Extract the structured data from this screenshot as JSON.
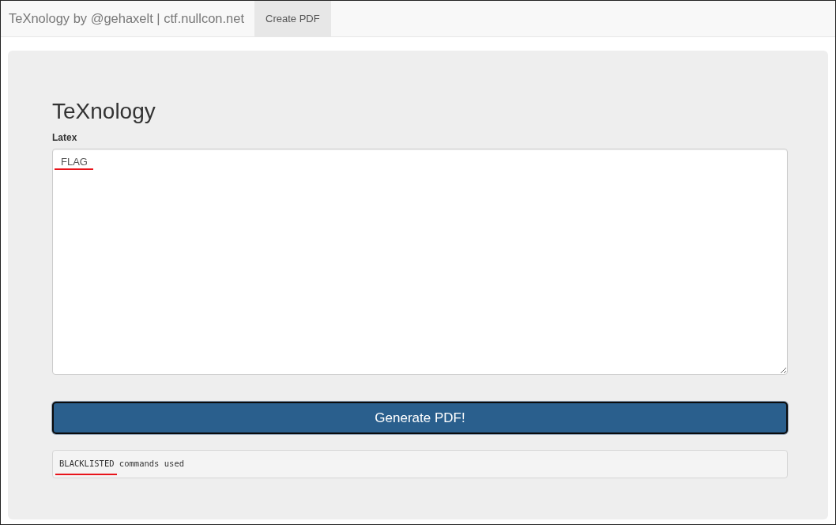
{
  "navbar": {
    "brand": "TeXnology by @gehaxelt | ctf.nullcon.net",
    "items": [
      {
        "label": "Create PDF",
        "selected": true
      }
    ]
  },
  "form": {
    "title": "TeXnology",
    "field_label": "Latex",
    "latex": {
      "value": "FLAG",
      "underlined": true
    },
    "submit": "Generate PDF!",
    "output": {
      "parts": [
        {
          "text": "BLACKLISTED",
          "underlined": true
        },
        {
          "text": "commands used",
          "underlined": false
        }
      ]
    }
  }
}
